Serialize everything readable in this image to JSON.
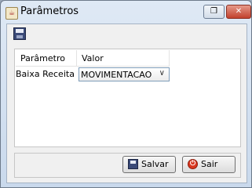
{
  "window": {
    "title": "Parâmetros",
    "restore_glyph": "❐",
    "close_glyph": "✕"
  },
  "toolbar": {
    "save_icon": "save-icon"
  },
  "table": {
    "columns": [
      "Parâmetro",
      "Valor"
    ],
    "rows": [
      {
        "parametro": "Baixa Receita",
        "valor": "MOVIMENTACAO"
      }
    ],
    "combo_arrow": "∨"
  },
  "buttons": {
    "salvar": "Salvar",
    "sair": "Sair"
  }
}
